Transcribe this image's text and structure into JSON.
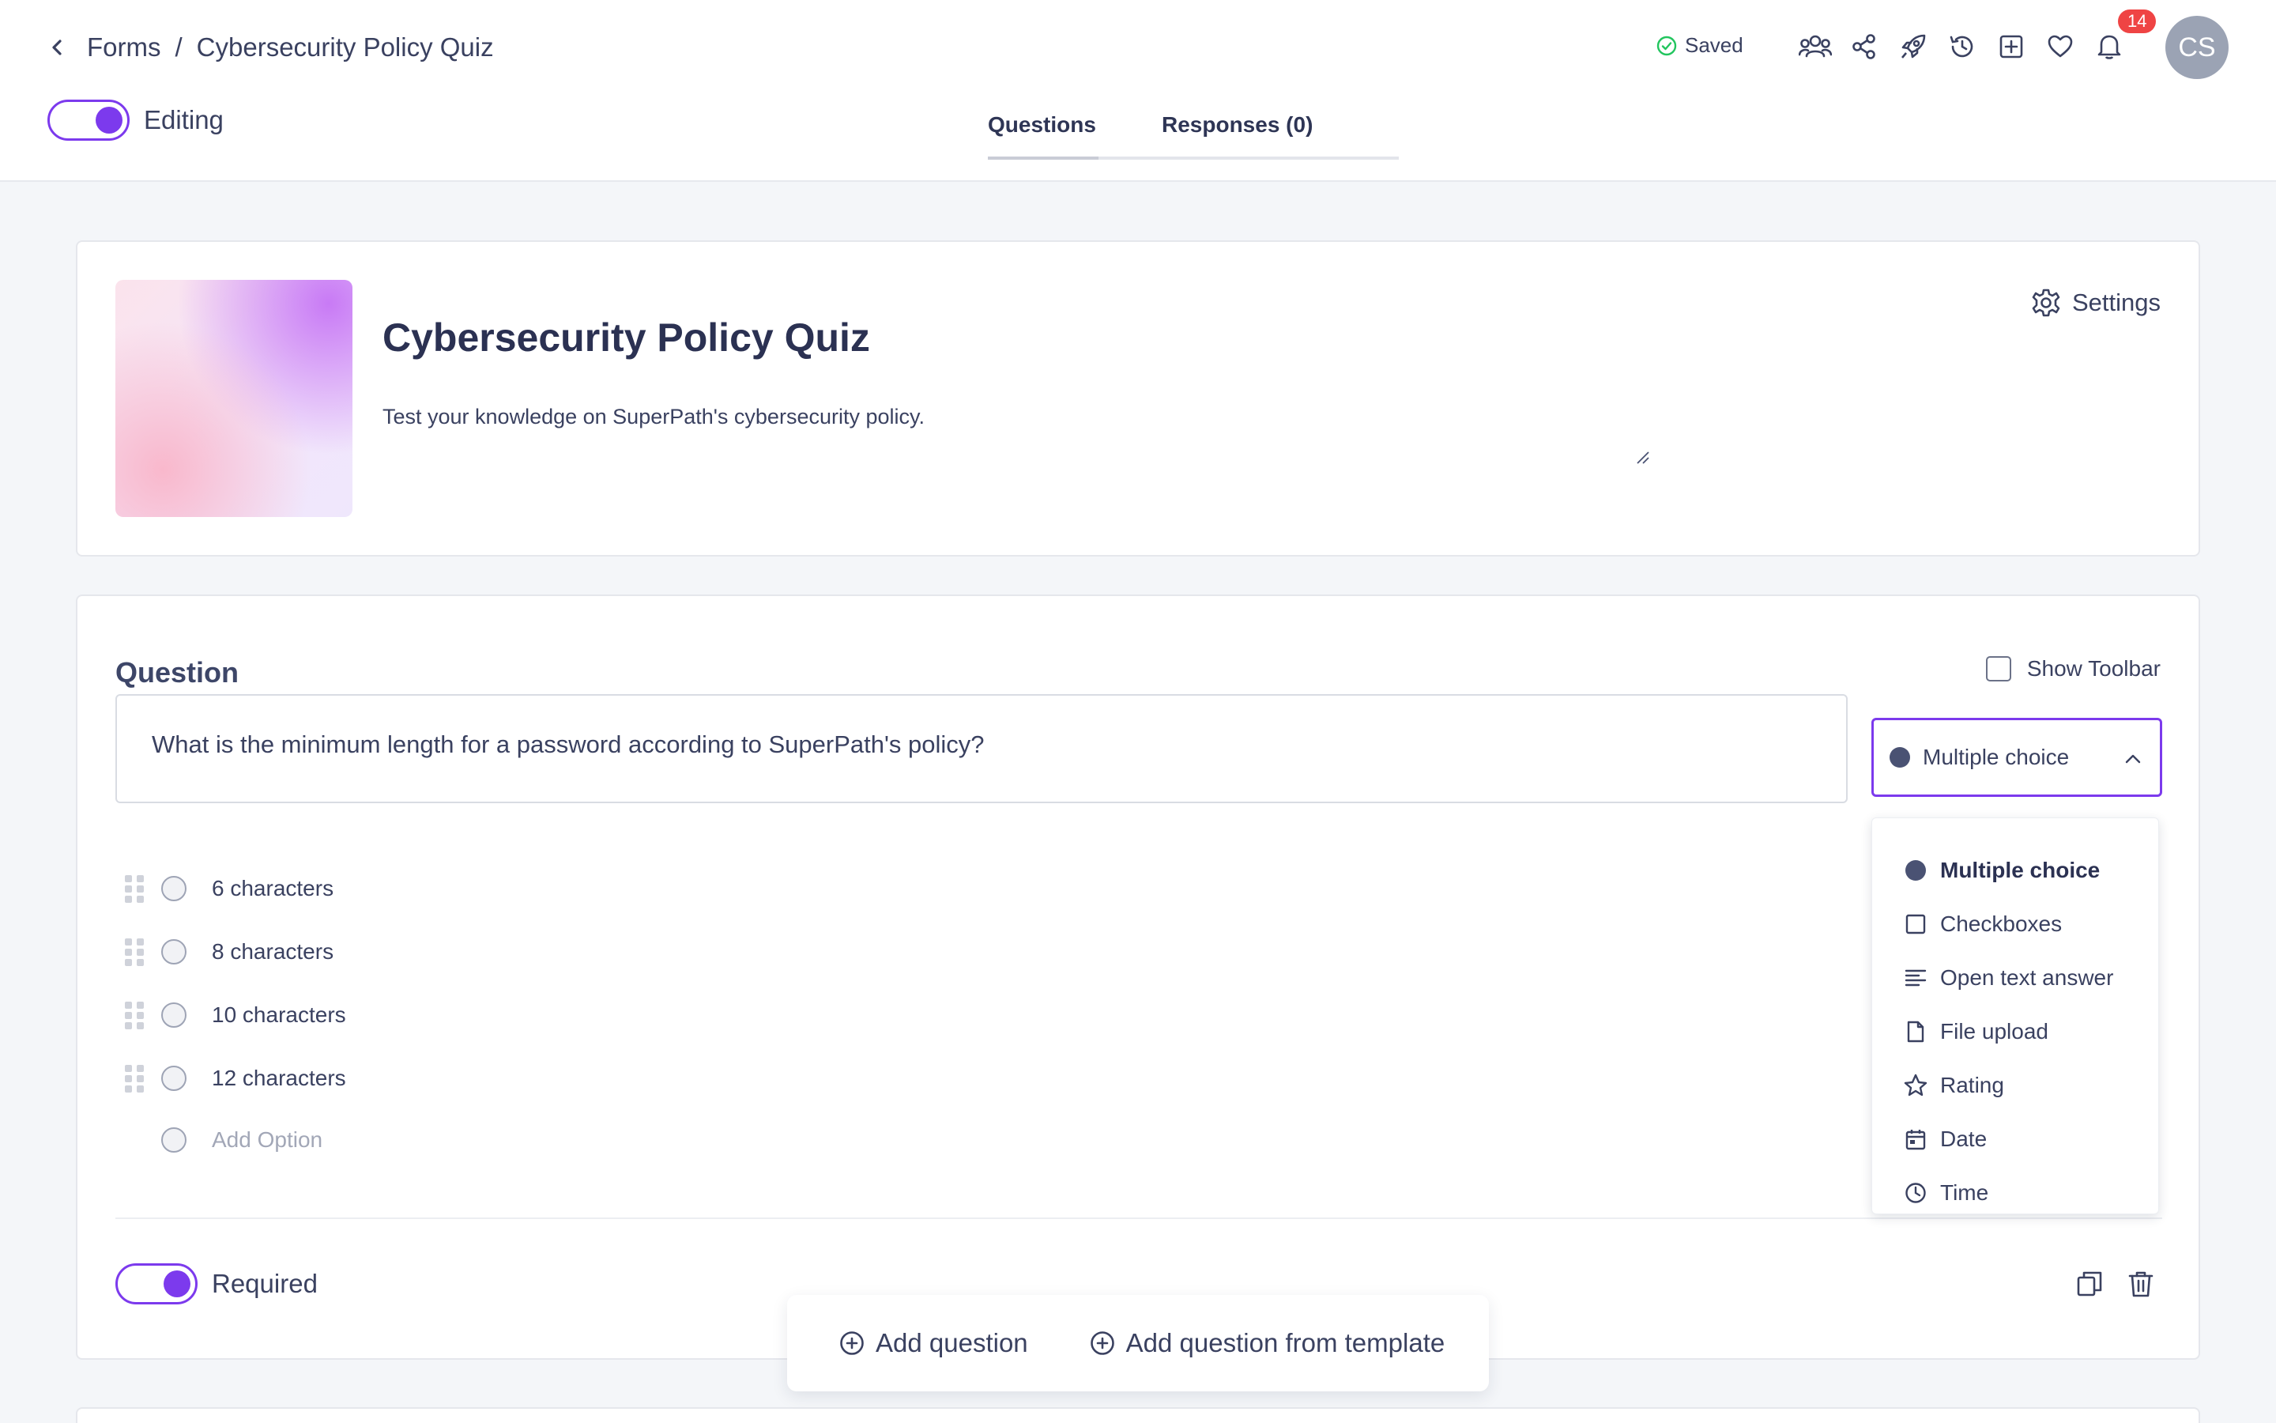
{
  "breadcrumb": {
    "parent": "Forms",
    "separator": "/",
    "current": "Cybersecurity Policy Quiz"
  },
  "mode_toggle": {
    "label": "Editing",
    "on": true
  },
  "tabs": [
    {
      "label": "Questions",
      "active": true
    },
    {
      "label": "Responses (0)",
      "active": false
    }
  ],
  "status": {
    "saved_label": "Saved"
  },
  "header_icons": [
    "team-icon",
    "share-icon",
    "rocket-icon",
    "history-icon",
    "add-box-icon",
    "heart-icon",
    "bell-icon"
  ],
  "notifications": {
    "count": "14"
  },
  "user": {
    "initials": "CS"
  },
  "form": {
    "title": "Cybersecurity Policy Quiz",
    "description": "Test your knowledge on SuperPath's cybersecurity policy.",
    "settings_label": "Settings"
  },
  "question": {
    "heading": "Question",
    "show_toolbar_label": "Show Toolbar",
    "text": "What is the minimum length for a password according to SuperPath's policy?",
    "type_selected": "Multiple choice",
    "options": [
      "6 characters",
      "8 characters",
      "10 characters",
      "12 characters"
    ],
    "add_option_placeholder": "Add Option",
    "required_label": "Required",
    "required": true
  },
  "type_menu": {
    "items": [
      {
        "label": "Multiple choice",
        "icon": "radio-filled-icon",
        "selected": true
      },
      {
        "label": "Checkboxes",
        "icon": "checkbox-icon"
      },
      {
        "label": "Open text answer",
        "icon": "text-lines-icon"
      },
      {
        "label": "File upload",
        "icon": "file-icon"
      },
      {
        "label": "Rating",
        "icon": "star-icon"
      },
      {
        "label": "Date",
        "icon": "calendar-icon"
      },
      {
        "label": "Time",
        "icon": "clock-icon"
      }
    ]
  },
  "bottom_actions": {
    "add_question": "Add question",
    "add_from_template": "Add question from template"
  },
  "colors": {
    "accent": "#7c3aed",
    "badge": "#ef4444",
    "saved_check": "#22c55e"
  }
}
